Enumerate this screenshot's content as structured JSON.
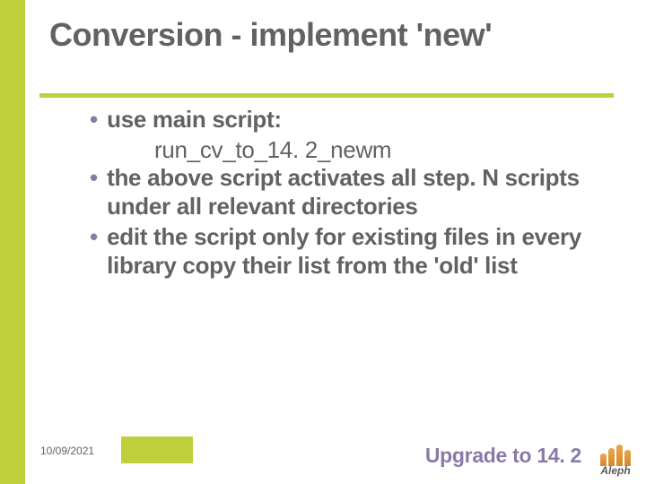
{
  "title": "Conversion - implement 'new'",
  "bullets": [
    {
      "lead": "use main script:",
      "sub": "run_cv_to_14. 2_newm"
    },
    {
      "lead": "the above script activates all step. N scripts under all relevant directories",
      "sub": ""
    },
    {
      "lead": "edit the script only for existing files in every library copy their list from the 'old' list",
      "sub": ""
    }
  ],
  "date": "10/09/2021",
  "footer_title": "Upgrade to 14. 2",
  "logo_text": "Aleph"
}
